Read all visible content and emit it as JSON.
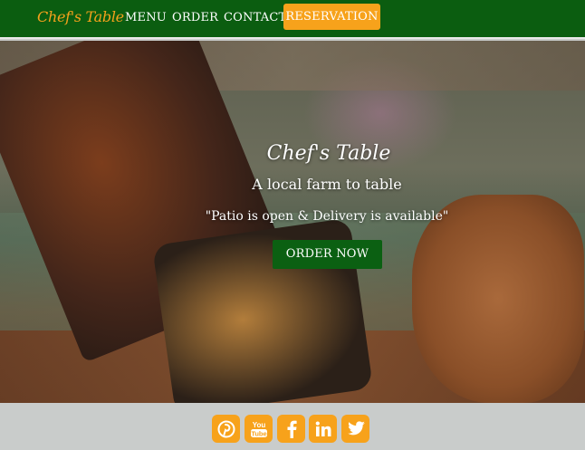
{
  "nav": {
    "brand": "Chef's Table",
    "links": [
      "MENU",
      "ORDER",
      "CONTACT"
    ],
    "reservation_label": "RESERVATION"
  },
  "hero": {
    "title": "Chef's Table",
    "subtitle": "A local farm to table",
    "note": "\"Patio is open & Delivery is available\"",
    "cta_label": "ORDER NOW"
  },
  "footer": {
    "social_icons": [
      "pinterest-icon",
      "youtube-icon",
      "facebook-icon",
      "linkedin-icon",
      "twitter-icon"
    ],
    "youtube_text": "You Tube"
  },
  "colors": {
    "nav_bg": "#0b5d10",
    "accent": "#f7a21b",
    "cta_bg": "#0b6012",
    "footer_bg": "#c9cccb"
  }
}
